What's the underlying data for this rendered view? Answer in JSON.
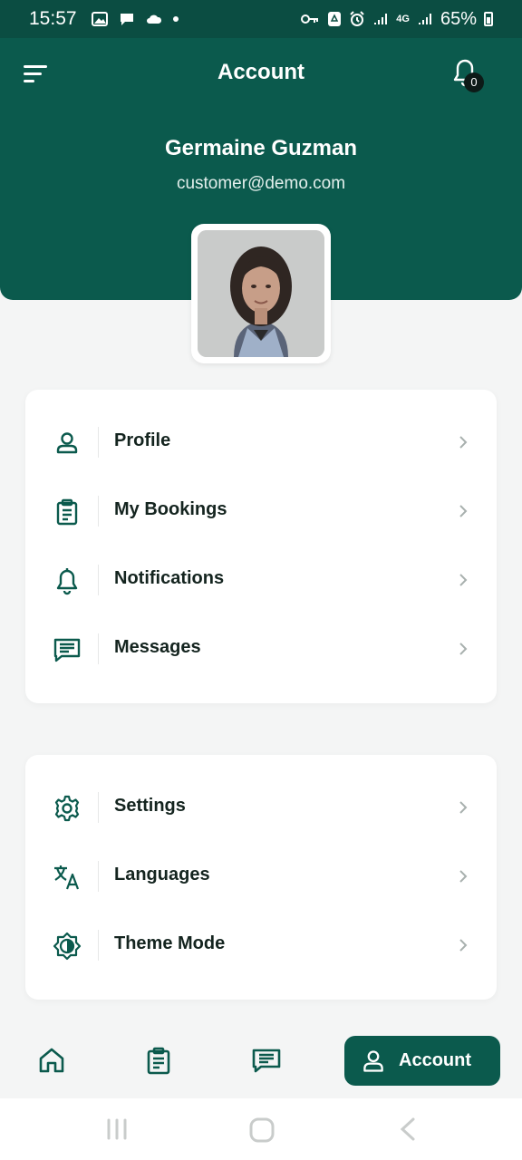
{
  "status_bar": {
    "time": "15:57",
    "battery": "65%",
    "network": "4G",
    "left_icons": [
      "image-icon",
      "chat-bubble-icon",
      "cloud-icon",
      "dot-icon"
    ],
    "right_icons": [
      "key-icon",
      "recycle-icon",
      "alarm-icon",
      "signal-icon",
      "signal-icon",
      "battery-icon"
    ]
  },
  "header": {
    "title": "Account",
    "notification_count": "0",
    "user_name": "Germaine Guzman",
    "user_email": "customer@demo.com"
  },
  "menu_group_1": [
    {
      "label": "Profile",
      "icon": "person-icon"
    },
    {
      "label": "My Bookings",
      "icon": "clipboard-icon"
    },
    {
      "label": "Notifications",
      "icon": "bell-icon"
    },
    {
      "label": "Messages",
      "icon": "message-icon"
    }
  ],
  "menu_group_2": [
    {
      "label": "Settings",
      "icon": "gear-icon"
    },
    {
      "label": "Languages",
      "icon": "translate-icon"
    },
    {
      "label": "Theme Mode",
      "icon": "brightness-icon"
    }
  ],
  "bottom_nav": {
    "items": [
      {
        "icon": "home-icon"
      },
      {
        "icon": "clipboard-icon"
      },
      {
        "icon": "message-icon"
      }
    ],
    "active_label": "Account",
    "active_icon": "person-icon"
  },
  "colors": {
    "primary": "#0b5a4d",
    "status_bar": "#0b4d42",
    "background": "#f4f5f5"
  }
}
